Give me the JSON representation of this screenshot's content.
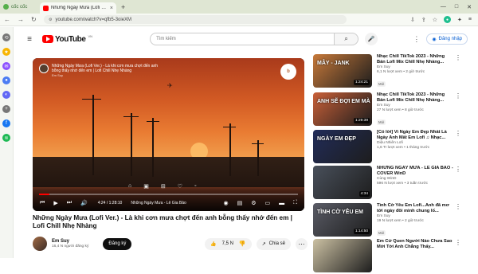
{
  "browser": {
    "brand": "cốc cốc",
    "tab_title": "Những Ngày Mưa (Lofi Ver.) - ...",
    "tab_close": "×",
    "new_tab": "+",
    "url": "youtube.com/watch?v=qfb5-3oieXM",
    "window_controls": [
      "—",
      "□",
      "✕"
    ],
    "nav_icons": [
      "back-icon",
      "forward-icon",
      "reload-icon"
    ],
    "tool_icons": [
      "download-icon",
      "share-icon",
      "star-icon",
      "menu-icon"
    ]
  },
  "sidebar_icons": [
    "history-icon",
    "extensions-icon",
    "messenger-icon",
    "messenger-icon",
    "discord-icon",
    "plus-icon",
    "facebook-icon",
    "spotify-icon"
  ],
  "header": {
    "logo_text": "YouTube",
    "region": "VN",
    "search_placeholder": "Tìm kiếm",
    "signin": "Đăng nhập"
  },
  "player": {
    "overlay_title": "Những Ngày Mưa (Lofi Ver.) - Là khi cơn mưa chợt đến anh bỗng thấy nhớ đến em | Lofi Chill Nhẹ Nhàng",
    "overlay_channel": "Em Suy",
    "watermark": "b",
    "progress_pct": 4,
    "time": "4:24 / 1:28:10",
    "chapter": "Những Ngày Mưa - Lê Gia Bảo",
    "center_icons": [
      "home-icon",
      "copy-icon",
      "plus-icon",
      "heart-icon",
      "user-icon"
    ],
    "control_icons": [
      "prev-icon",
      "play-icon",
      "next-icon",
      "volume-icon"
    ],
    "right_icons": [
      "autoplay-icon",
      "subtitles-icon",
      "settings-icon",
      "miniplayer-icon",
      "theater-icon",
      "fullscreen-icon"
    ]
  },
  "video": {
    "title": "Những Ngày Mưa (Lofi Ver.) - Là khi cơn mưa chợt đến anh bỗng thấy nhớ đến em | Lofi Chill Nhẹ Nhàng",
    "channel": "Em Suy",
    "subs": "16,4 N người đăng ký",
    "subscribe": "Đăng ký",
    "likes": "7,5 N",
    "share": "Chia sẻ"
  },
  "recommendations": [
    {
      "title": "Nhạc Chill TikTok 2023 - Những Bản Lofi Mix Chill Nhẹ Nhàng...",
      "channel": "Em Suy",
      "stats": "6,1 N lượt xem • 2 giờ trước",
      "badge": "Mới",
      "duration": "1:24:21",
      "thumb_text": "MÂY - JANK",
      "thumb_bg": "#c7793a"
    },
    {
      "title": "Nhạc Chill TikTok 2023 - Những Bản Lofi Mix Chill Nhẹ Nhàng...",
      "channel": "Em Suy",
      "stats": "27 N lượt xem • 8 giờ trước",
      "badge": "Mới",
      "duration": "1:29:39",
      "thumb_text": "ANH SẼ ĐỢI EM MÀ",
      "thumb_bg": "#c96038"
    },
    {
      "title": "[Có lời] Vì Ngày Em Đẹp Nhất Là Ngày Anh Mất Em Lofi ♫ Nhạc...",
      "channel": "Diệu Nhiên Lofi",
      "stats": "1,6 Tr lượt xem • 1 tháng trước",
      "badge": "",
      "duration": "",
      "thumb_text": "NGÀY EM ĐẸP",
      "thumb_bg": "#212c59"
    },
    {
      "title": "NHỮNG NGÀY MƯA - LÊ GIA BẢO - COVER WinD",
      "channel": "Cùng WinD",
      "stats": "596 N lượt xem • 3 tuần trước",
      "badge": "",
      "duration": "4:34",
      "thumb_text": "",
      "thumb_bg": "#49505b"
    },
    {
      "title": "Tình Cờ Yêu Em Lofi...Anh đã mơ tới ngày đôi mình chung lố...",
      "channel": "Em Suy",
      "stats": "19 N lượt xem • 2 giờ trước",
      "badge": "Mới",
      "duration": "1:14:50",
      "thumb_text": "TÌNH CỜ YÊU EM",
      "thumb_bg": "#5a5c66"
    },
    {
      "title": "Em Cứ Quen Người Nào Chưa Sao Mới Tới Anh Chẳng Thấy...",
      "channel": "",
      "stats": "",
      "badge": "",
      "duration": "",
      "thumb_text": "",
      "thumb_bg": "#ccc1a3"
    }
  ]
}
